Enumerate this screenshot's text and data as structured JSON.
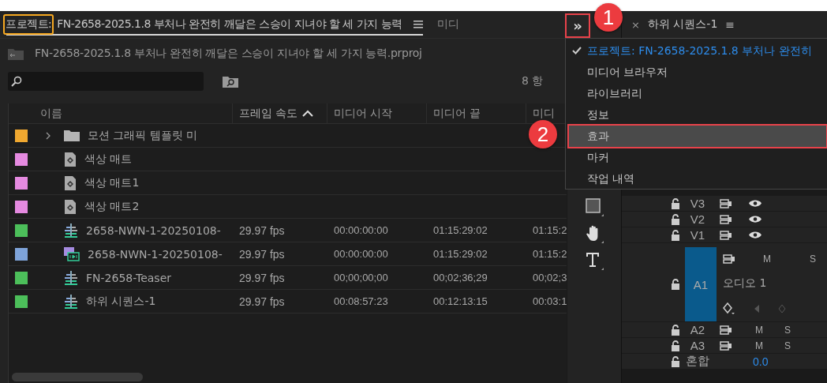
{
  "project_tab": {
    "prefix": "프로젝트:",
    "title": "FN-2658-2025.1.8 부처나 완전히 깨달은 스승이 지녀야 할 세 가지 능력",
    "highlighted": true,
    "selected": true
  },
  "media_tab": {
    "label": "미디",
    "selected": false
  },
  "overflow_button": {
    "label": "»",
    "highlighted": true
  },
  "project_path": "FN-2658-2025.1.8 부처나 완전히 깨달은 스승이 지녀야 할 세 가지 능력.prproj",
  "item_count": "8 항",
  "table": {
    "columns": [
      {
        "label": "이름",
        "sorted": false
      },
      {
        "label": "프레임 속도",
        "sorted": true
      },
      {
        "label": "미디어 시작",
        "sorted": false
      },
      {
        "label": "미디어 끝",
        "sorted": false
      },
      {
        "label": "미디",
        "sorted": false
      }
    ],
    "rows": [
      {
        "color": "#f0a830",
        "kind": "folder",
        "expandable": true,
        "name": "모션 그래픽 템플릿 미",
        "fps": "",
        "start": "",
        "end": "",
        "column_5": ""
      },
      {
        "color": "#e58ae0",
        "kind": "matte",
        "expandable": false,
        "name": "색상 매트",
        "fps": "",
        "start": "",
        "end": "",
        "column_5": ""
      },
      {
        "color": "#e58ae0",
        "kind": "matte",
        "expandable": false,
        "name": "색상 매트1",
        "fps": "",
        "start": "",
        "end": "",
        "column_5": ""
      },
      {
        "color": "#e58ae0",
        "kind": "matte",
        "expandable": false,
        "name": "색상 매트2",
        "fps": "",
        "start": "",
        "end": "",
        "column_5": ""
      },
      {
        "color": "#4cbf5a",
        "kind": "sequence",
        "expandable": false,
        "name": "2658-NWN-1-20250108-",
        "fps": "29.97 fps",
        "start": "00:00:00:00",
        "end": "01:15:29:02",
        "column_5": "01:15:2"
      },
      {
        "color": "#7ea3d9",
        "kind": "clip",
        "expandable": false,
        "name": "2658-NWN-1-20250108-",
        "fps": "29.97 fps",
        "start": "00:00:00:00",
        "end": "01:15:29:02",
        "column_5": "01:15:2"
      },
      {
        "color": "#4cbf5a",
        "kind": "sequence",
        "expandable": false,
        "name": "FN-2658-Teaser",
        "fps": "29.97 fps",
        "start": "00;00;00;00",
        "end": "00;02;36;29",
        "column_5": "00;02;3"
      },
      {
        "color": "#4cbf5a",
        "kind": "sequence",
        "expandable": false,
        "name": "하위 시퀀스-1",
        "fps": "29.97 fps",
        "start": "00:08:57:23",
        "end": "00:12:13:15",
        "column_5": "00:03:1"
      }
    ]
  },
  "timeline_tab": {
    "close": "×",
    "title": "하위 시퀀스-1",
    "menu": "≡"
  },
  "tracks": [
    {
      "kind": "video",
      "name": "V3"
    },
    {
      "kind": "video",
      "name": "V2"
    },
    {
      "kind": "video",
      "name": "V1"
    },
    {
      "kind": "audio_expanded",
      "name": "A1",
      "label": "오디오 1",
      "selected": true,
      "mute": "M",
      "solo": "S"
    },
    {
      "kind": "audio",
      "name": "A2",
      "selected": false,
      "mute": "M",
      "solo": "S"
    },
    {
      "kind": "audio",
      "name": "A3",
      "selected": false,
      "mute": "M",
      "solo": "S"
    },
    {
      "kind": "mix",
      "name": "혼합",
      "value": "0.0"
    }
  ],
  "panel_menu": [
    {
      "label": "프로젝트: FN-2658-2025.1.8 부처나 완전히",
      "checked": true,
      "highlighted": false
    },
    {
      "label": "미디어 브라우저",
      "checked": false,
      "highlighted": false
    },
    {
      "label": "라이브러리",
      "checked": false,
      "highlighted": false
    },
    {
      "label": "정보",
      "checked": false,
      "highlighted": false
    },
    {
      "label": "효과",
      "checked": false,
      "highlighted": true
    },
    {
      "label": "마커",
      "checked": false,
      "highlighted": false
    },
    {
      "label": "작업 내역",
      "checked": false,
      "highlighted": false
    }
  ],
  "callouts": [
    {
      "number": "1"
    },
    {
      "number": "2"
    }
  ]
}
